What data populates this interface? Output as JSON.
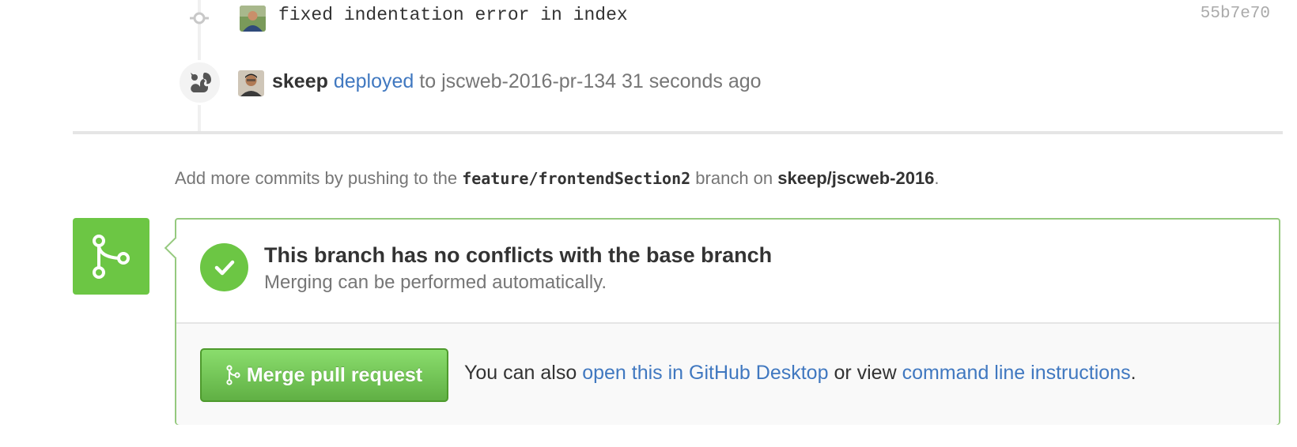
{
  "timeline": {
    "commit": {
      "message": "fixed indentation error in index",
      "sha": "55b7e70"
    },
    "deploy": {
      "user": "skeep",
      "action": "deployed",
      "to_text": "to",
      "environment": "jscweb-2016-pr-134",
      "time": "31 seconds ago"
    }
  },
  "hint": {
    "prefix": "Add more commits by pushing to the",
    "branch": "feature/frontendSection2",
    "middle": "branch on",
    "repo": "skeep/jscweb-2016",
    "suffix": "."
  },
  "merge": {
    "status_title": "This branch has no conflicts with the base branch",
    "status_subtitle": "Merging can be performed automatically.",
    "button_label": "Merge pull request",
    "also_prefix": "You can also",
    "desktop_link": "open this in GitHub Desktop",
    "or_view": "or view",
    "cli_link": "command line instructions",
    "suffix": "."
  },
  "colors": {
    "success_green": "#6cc644",
    "link_blue": "#4078c0",
    "border_green": "#95c97e"
  },
  "icons": {
    "commit": "git-commit-icon",
    "deploy": "squirrel-icon",
    "merge": "git-merge-icon",
    "check": "check-icon"
  }
}
